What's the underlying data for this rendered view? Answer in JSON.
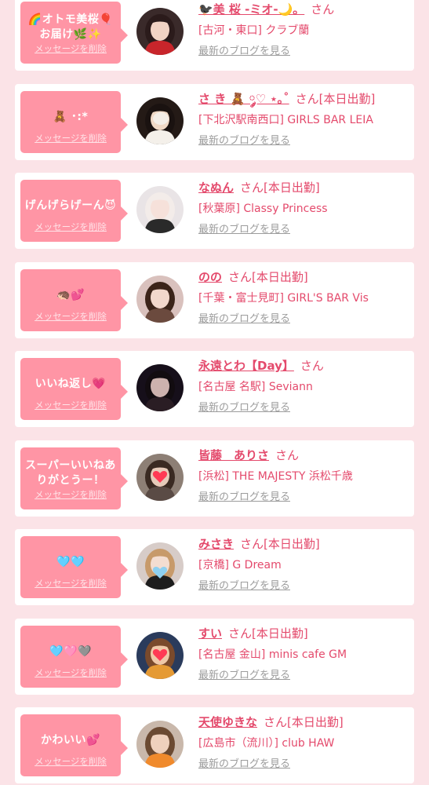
{
  "labels": {
    "delete": "メッセージを削除",
    "blog": "最新のブログを見る"
  },
  "colors": {
    "page_background": "#fbe3e7",
    "card_background": "#ffffff",
    "bubble": "#ff95a5",
    "accent_text": "#e44a6c",
    "muted_link": "#9c9c9c"
  },
  "cards": [
    {
      "message": "🌈オトモ美桜🎈お届け🌿✨",
      "name": "🐦‍⬛美 桜 -ミオ-🌙。",
      "suffix": "さん",
      "shop": "[古河・東口] クラブ蘭",
      "avatar_icon": "girl-red-outfit-avatar"
    },
    {
      "message": "🧸 ･:*",
      "name": "さ き 🧸 ༘♡ ⋆｡˚",
      "suffix": "さん[本日出勤]",
      "shop": "[下北沢駅南西口] GIRLS BAR LEIA",
      "avatar_icon": "girl-dark-hair-avatar"
    },
    {
      "message": "げんげらげーん😈",
      "name": "なぬん",
      "suffix": "さん[本日出勤]",
      "shop": "[秋葉原] Classy Princess",
      "avatar_icon": "girl-light-hair-avatar"
    },
    {
      "message": "🦔💕",
      "name": "のの",
      "suffix": "さん[本日出勤]",
      "shop": "[千葉・富士見町] GIRL'S BAR Vis",
      "avatar_icon": "girl-brown-hair-avatar"
    },
    {
      "message": "いいね返し💗",
      "name": "永遠とわ【Day】",
      "suffix": "さん",
      "shop": "[名古屋 名駅] Seviann",
      "avatar_icon": "girl-dim-photo-avatar"
    },
    {
      "message": "スーパーいいねありがとうー！",
      "name": "皆藤　ありさ",
      "suffix": "さん",
      "shop": "[浜松] THE MAJESTY 浜松千歳",
      "avatar_icon": "girl-heart-sticker-avatar"
    },
    {
      "message": "🩵🩵",
      "name": "みさき",
      "suffix": "さん[本日出勤]",
      "shop": "[京橋] G Dream",
      "avatar_icon": "girl-blue-heart-avatar"
    },
    {
      "message": "🩵🩷🩶",
      "name": "すい",
      "suffix": "さん[本日出勤]",
      "shop": "[名古屋 金山] minis cafe GM",
      "avatar_icon": "girl-orange-light-avatar"
    },
    {
      "message": "かわいい💕",
      "name": "天使ゆきな",
      "suffix": "さん[本日出勤]",
      "shop": "[広島市（流川）] club HAW",
      "avatar_icon": "girl-orange-top-avatar"
    }
  ]
}
